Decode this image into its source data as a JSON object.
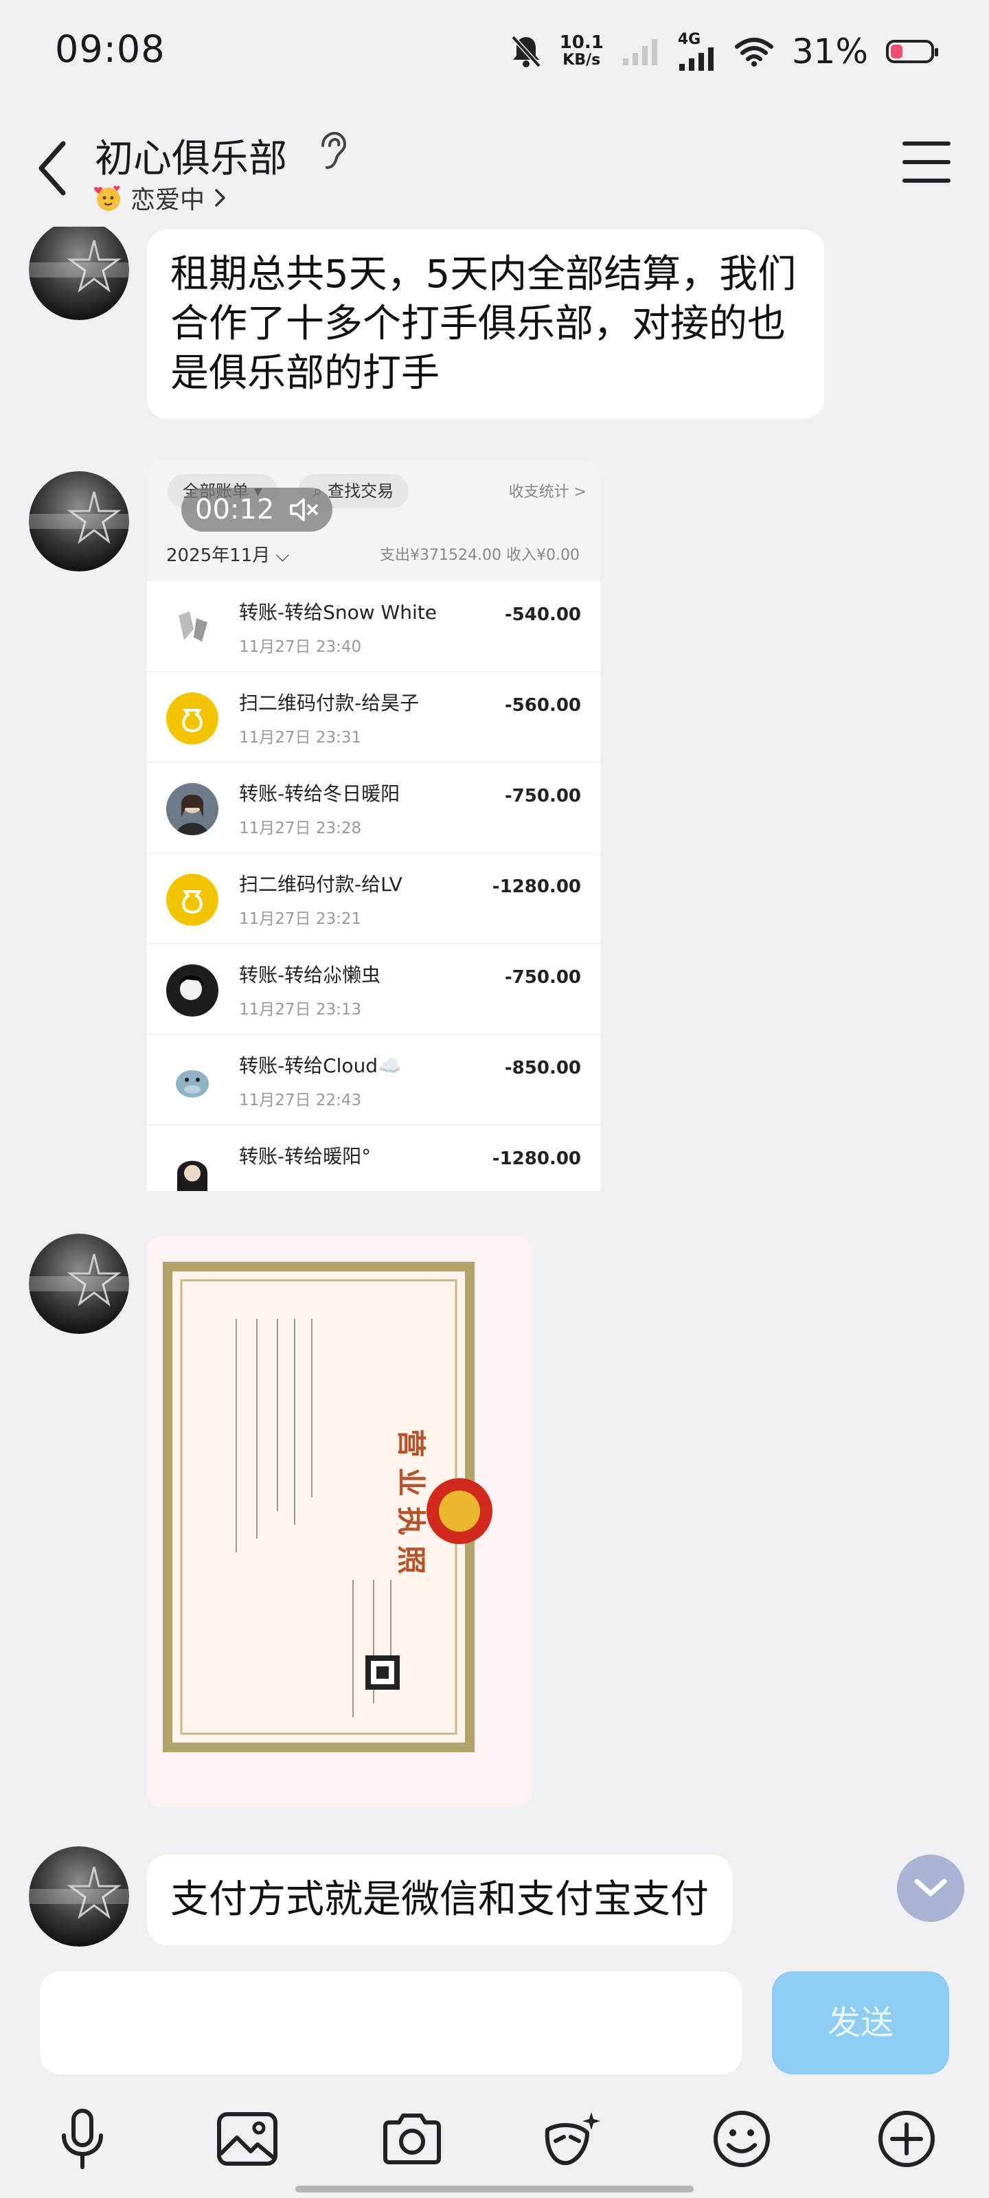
{
  "status_bar": {
    "time": "09:08",
    "net_speed_value": "10.1",
    "net_speed_unit": "KB/s",
    "network": "4G",
    "battery": "31%",
    "battery_level_percent": 31
  },
  "header": {
    "title": "初心俱乐部",
    "subtitle": "恋爱中"
  },
  "messages": {
    "msg1": "租期总共5天，5天内全部结算，我们合作了十多个打手俱乐部，对接的也是俱乐部的打手",
    "msg4": "支付方式就是微信和支付宝支付"
  },
  "bill": {
    "filter_label": "全部账单 ▾",
    "search_label": "查找交易",
    "stats_label": "收支统计 >",
    "video_time": "00:12",
    "month": "2025年11月 ⌵",
    "summary": "支出¥371524.00 收入¥0.00",
    "transactions": [
      {
        "title": "转账-转给Snow White",
        "time": "11月27日 23:40",
        "amount": "-540.00"
      },
      {
        "title": "扫二维码付款-给昊子",
        "time": "11月27日 23:31",
        "amount": "-560.00"
      },
      {
        "title": "转账-转给冬日暖阳",
        "time": "11月27日 23:28",
        "amount": "-750.00"
      },
      {
        "title": "扫二维码付款-给LV",
        "time": "11月27日 23:21",
        "amount": "-1280.00"
      },
      {
        "title": "转账-转给尛懒虫",
        "time": "11月27日 23:13",
        "amount": "-750.00"
      },
      {
        "title": "转账-转给Cloud☁️",
        "time": "11月27日 22:43",
        "amount": "-850.00"
      },
      {
        "title": "转账-转给暖阳°",
        "time": "",
        "amount": "-1280.00"
      }
    ]
  },
  "license": {
    "title": "营 业 执 照"
  },
  "input": {
    "placeholder": "",
    "send_label": "发送"
  },
  "colors": {
    "background": "#f0f0f4",
    "send_button": "#8ecdf3",
    "battery_low": "#f0506e"
  }
}
